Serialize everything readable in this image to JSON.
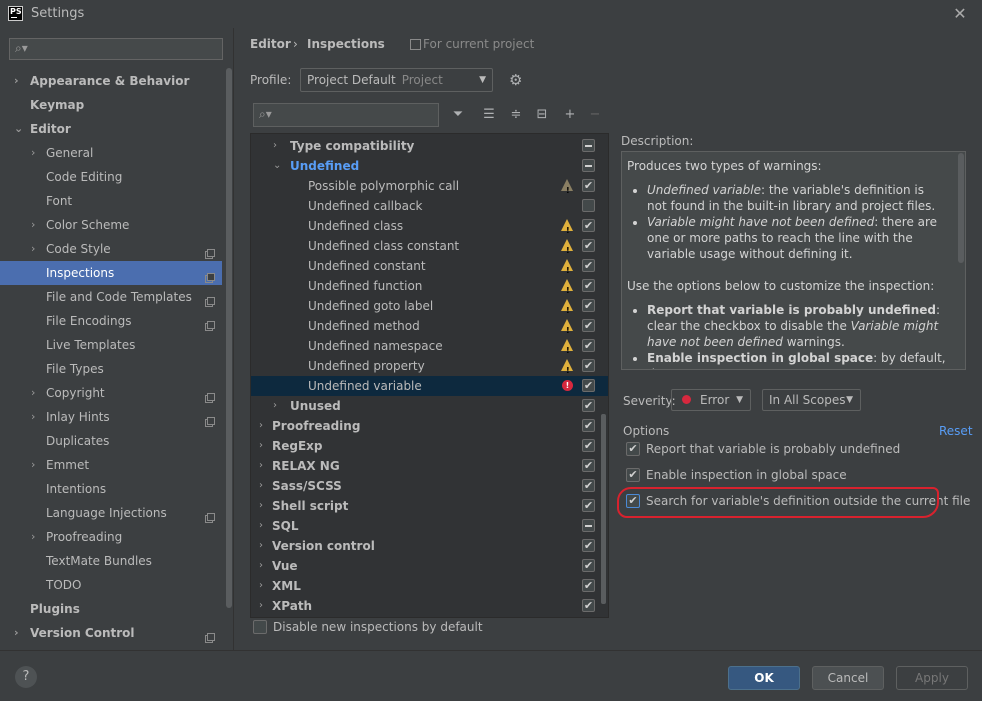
{
  "window": {
    "title": "Settings",
    "logo_text": "PS"
  },
  "colors": {
    "selection": "#4b6eaf",
    "link": "#589df6",
    "warning": "#e0b13c",
    "error": "#d6283e",
    "highlight": "#d8222e"
  },
  "sidebar": {
    "search_placeholder": "",
    "items": [
      {
        "label": "Appearance & Behavior",
        "level": 0,
        "bold": true,
        "arrow": "›",
        "project_icon": false
      },
      {
        "label": "Keymap",
        "level": 0,
        "bold": true,
        "arrow": "",
        "project_icon": false
      },
      {
        "label": "Editor",
        "level": 0,
        "bold": true,
        "arrow": "⌄",
        "project_icon": false
      },
      {
        "label": "General",
        "level": 1,
        "arrow": "›",
        "project_icon": false
      },
      {
        "label": "Code Editing",
        "level": 1,
        "arrow": "",
        "project_icon": false
      },
      {
        "label": "Font",
        "level": 1,
        "arrow": "",
        "project_icon": false
      },
      {
        "label": "Color Scheme",
        "level": 1,
        "arrow": "›",
        "project_icon": false
      },
      {
        "label": "Code Style",
        "level": 1,
        "arrow": "›",
        "project_icon": true
      },
      {
        "label": "Inspections",
        "level": 1,
        "arrow": "",
        "project_icon": true,
        "selected": true
      },
      {
        "label": "File and Code Templates",
        "level": 1,
        "arrow": "",
        "project_icon": true
      },
      {
        "label": "File Encodings",
        "level": 1,
        "arrow": "",
        "project_icon": true
      },
      {
        "label": "Live Templates",
        "level": 1,
        "arrow": "",
        "project_icon": false
      },
      {
        "label": "File Types",
        "level": 1,
        "arrow": "",
        "project_icon": false
      },
      {
        "label": "Copyright",
        "level": 1,
        "arrow": "›",
        "project_icon": true
      },
      {
        "label": "Inlay Hints",
        "level": 1,
        "arrow": "›",
        "project_icon": true
      },
      {
        "label": "Duplicates",
        "level": 1,
        "arrow": "",
        "project_icon": false
      },
      {
        "label": "Emmet",
        "level": 1,
        "arrow": "›",
        "project_icon": false
      },
      {
        "label": "Intentions",
        "level": 1,
        "arrow": "",
        "project_icon": false
      },
      {
        "label": "Language Injections",
        "level": 1,
        "arrow": "",
        "project_icon": true
      },
      {
        "label": "Proofreading",
        "level": 1,
        "arrow": "›",
        "project_icon": false
      },
      {
        "label": "TextMate Bundles",
        "level": 1,
        "arrow": "",
        "project_icon": false
      },
      {
        "label": "TODO",
        "level": 1,
        "arrow": "",
        "project_icon": false
      },
      {
        "label": "Plugins",
        "level": 0,
        "bold": true,
        "arrow": "",
        "project_icon": false
      },
      {
        "label": "Version Control",
        "level": 0,
        "bold": true,
        "arrow": "›",
        "project_icon": true
      }
    ]
  },
  "header": {
    "breadcrumb_editor": "Editor",
    "breadcrumb_sep": "›",
    "breadcrumb_inspections": "Inspections",
    "scope_hint": "For current project"
  },
  "profile": {
    "label": "Profile:",
    "value": "Project Default",
    "sub": "Project"
  },
  "tree": {
    "search_placeholder": "",
    "rows": [
      {
        "label": "Type compatibility",
        "indent": 1,
        "arrow": "›",
        "style": "bold",
        "check": "partial",
        "marker": ""
      },
      {
        "label": "Undefined",
        "indent": 1,
        "arrow": "⌄",
        "style": "blue",
        "check": "partial",
        "marker": ""
      },
      {
        "label": "Possible polymorphic call",
        "indent": 2,
        "arrow": "",
        "style": "",
        "check": "checked",
        "marker": "warn-gray"
      },
      {
        "label": "Undefined callback",
        "indent": 2,
        "arrow": "",
        "style": "",
        "check": "unchecked",
        "marker": ""
      },
      {
        "label": "Undefined class",
        "indent": 2,
        "arrow": "",
        "style": "",
        "check": "checked",
        "marker": "warn"
      },
      {
        "label": "Undefined class constant",
        "indent": 2,
        "arrow": "",
        "style": "",
        "check": "checked",
        "marker": "warn"
      },
      {
        "label": "Undefined constant",
        "indent": 2,
        "arrow": "",
        "style": "",
        "check": "checked",
        "marker": "warn"
      },
      {
        "label": "Undefined function",
        "indent": 2,
        "arrow": "",
        "style": "",
        "check": "checked",
        "marker": "warn"
      },
      {
        "label": "Undefined goto label",
        "indent": 2,
        "arrow": "",
        "style": "",
        "check": "checked",
        "marker": "warn"
      },
      {
        "label": "Undefined method",
        "indent": 2,
        "arrow": "",
        "style": "",
        "check": "checked",
        "marker": "warn"
      },
      {
        "label": "Undefined namespace",
        "indent": 2,
        "arrow": "",
        "style": "",
        "check": "checked",
        "marker": "warn"
      },
      {
        "label": "Undefined property",
        "indent": 2,
        "arrow": "",
        "style": "",
        "check": "checked",
        "marker": "warn"
      },
      {
        "label": "Undefined variable",
        "indent": 2,
        "arrow": "",
        "style": "",
        "check": "checked",
        "marker": "error",
        "selected": true
      },
      {
        "label": "Unused",
        "indent": 1,
        "arrow": "›",
        "style": "bold",
        "check": "checked",
        "marker": ""
      },
      {
        "label": "Proofreading",
        "indent": 0,
        "arrow": "›",
        "style": "bold",
        "check": "checked",
        "marker": ""
      },
      {
        "label": "RegExp",
        "indent": 0,
        "arrow": "›",
        "style": "bold",
        "check": "checked",
        "marker": ""
      },
      {
        "label": "RELAX NG",
        "indent": 0,
        "arrow": "›",
        "style": "bold",
        "check": "checked",
        "marker": ""
      },
      {
        "label": "Sass/SCSS",
        "indent": 0,
        "arrow": "›",
        "style": "bold",
        "check": "checked",
        "marker": ""
      },
      {
        "label": "Shell script",
        "indent": 0,
        "arrow": "›",
        "style": "bold",
        "check": "checked",
        "marker": ""
      },
      {
        "label": "SQL",
        "indent": 0,
        "arrow": "›",
        "style": "bold",
        "check": "partial",
        "marker": ""
      },
      {
        "label": "Version control",
        "indent": 0,
        "arrow": "›",
        "style": "bold",
        "check": "checked",
        "marker": ""
      },
      {
        "label": "Vue",
        "indent": 0,
        "arrow": "›",
        "style": "bold",
        "check": "checked",
        "marker": ""
      },
      {
        "label": "XML",
        "indent": 0,
        "arrow": "›",
        "style": "bold",
        "check": "checked",
        "marker": ""
      },
      {
        "label": "XPath",
        "indent": 0,
        "arrow": "›",
        "style": "bold",
        "check": "checked",
        "marker": ""
      }
    ],
    "disable_new_label": "Disable new inspections by default",
    "disable_new_checked": false
  },
  "description": {
    "title": "Description:",
    "intro": "Produces two types of warnings:",
    "bullet1_em": "Undefined variable",
    "bullet1_rest": ": the variable's definition is not found in the built-in library and project files.",
    "bullet2_em": "Variable might have not been defined",
    "bullet2_rest": ": there are one or more paths to reach the line with the variable usage without defining it.",
    "options_intro": "Use the options below to customize the inspection:",
    "opt1_bold": "Report that variable is probably undefined",
    "opt1_rest1": ": clear the checkbox to disable the ",
    "opt1_em": "Variable might have not been defined",
    "opt1_rest2": " warnings.",
    "opt2_bold": "Enable inspection in global space",
    "opt2_rest": ": by default, the"
  },
  "severity": {
    "label": "Severity:",
    "value": "Error",
    "scope": "In All Scopes"
  },
  "options": {
    "label": "Options",
    "reset": "Reset",
    "items": [
      {
        "label": "Report that variable is probably undefined",
        "checked": true
      },
      {
        "label": "Enable inspection in global space",
        "checked": true
      },
      {
        "label": "Search for variable's definition outside the current file",
        "checked": true
      }
    ]
  },
  "footer": {
    "help": "?",
    "ok": "OK",
    "cancel": "Cancel",
    "apply": "Apply"
  }
}
